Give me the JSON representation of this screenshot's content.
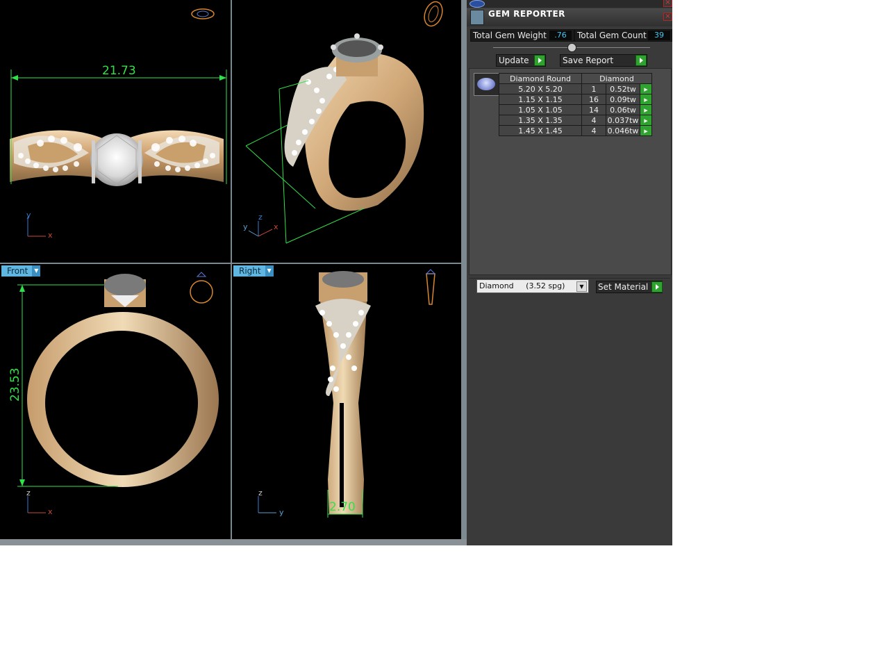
{
  "viewports": {
    "top_left": {
      "dimension": "21.73",
      "axis_y": "y",
      "axis_x": "x"
    },
    "top_right": {
      "axis_y": "y",
      "axis_z": "z",
      "axis_x": "x"
    },
    "bottom_left": {
      "label": "Front",
      "dimension": "23.53",
      "axis_z": "z",
      "axis_x": "x"
    },
    "bottom_right": {
      "label": "Right",
      "dimension": "2.70",
      "axis_z": "z",
      "axis_y": "y"
    }
  },
  "panel": {
    "title": "GEM REPORTER",
    "total_weight_label": "Total Gem Weight",
    "total_weight_value": ".76",
    "total_count_label": "Total Gem Count",
    "total_count_value": "39",
    "update_label": "Update",
    "save_report_label": "Save Report",
    "table": {
      "header_size": "Diamond Round",
      "header_type": "Diamond",
      "rows": [
        {
          "size": "5.20 X 5.20",
          "count": "1",
          "weight": "0.52tw"
        },
        {
          "size": "1.15 X 1.15",
          "count": "16",
          "weight": "0.09tw"
        },
        {
          "size": "1.05 X 1.05",
          "count": "14",
          "weight": "0.06tw"
        },
        {
          "size": "1.35 X 1.35",
          "count": "4",
          "weight": "0.037tw"
        },
        {
          "size": "1.45 X 1.45",
          "count": "4",
          "weight": "0.046tw"
        }
      ]
    },
    "material_select": "Diamond     (3.52 spg)",
    "set_material_label": "Set Material"
  },
  "colors": {
    "dimension": "#33e04a",
    "gold": "#d6b488",
    "tab": "#5fb6e0",
    "value": "#45c8f0"
  }
}
